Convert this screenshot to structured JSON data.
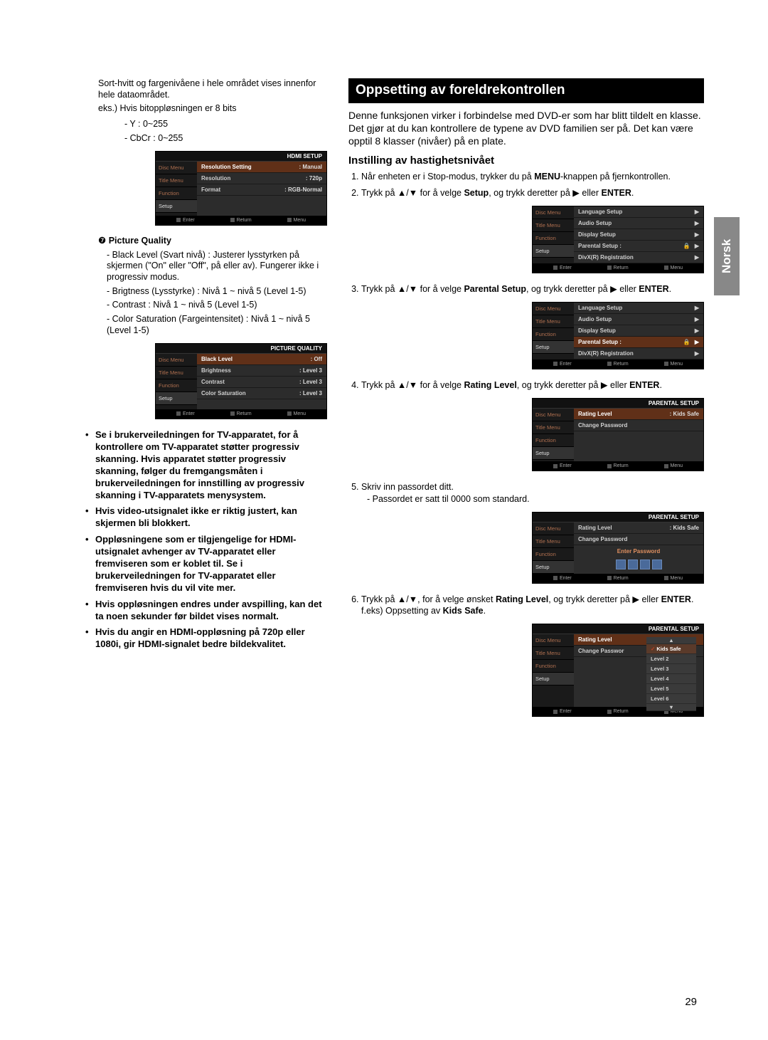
{
  "page_number": "29",
  "side_tab": "Norsk",
  "left": {
    "intro_lines": [
      "Sort-hvitt og fargenivåene i hele området vises innenfor hele dataområdet.",
      "eks.) Hvis bitoppløsningen er 8 bits"
    ],
    "ranges": [
      "- Y : 0~255",
      "- CbCr : 0~255"
    ],
    "osd_hdmi": {
      "title": "HDMI SETUP",
      "side": [
        "Disc Menu",
        "Title Menu",
        "Function",
        "Setup"
      ],
      "rows": [
        {
          "lbl": "Resolution Setting",
          "val": ": Manual",
          "hl": true
        },
        {
          "lbl": "Resolution",
          "val": ": 720p"
        },
        {
          "lbl": "Format",
          "val": ": RGB-Normal"
        }
      ],
      "foot": [
        "Enter",
        "Return",
        "Menu"
      ]
    },
    "pq_heading_num": "❼",
    "pq_heading": "Picture Quality",
    "pq_items": [
      "- Black Level (Svart nivå) : Justerer lysstyrken på skjermen (\"On\" eller \"Off\", på eller av). Fungerer ikke i progressiv modus.",
      "- Brigtness (Lysstyrke) : Nivå 1 ~ nivå 5 (Level 1-5)",
      "- Contrast : Nivå 1 ~ nivå 5 (Level 1-5)",
      "- Color Saturation (Fargeintensitet) : Nivå 1 ~ nivå 5 (Level 1-5)"
    ],
    "osd_pq": {
      "title": "PICTURE QUALITY",
      "side": [
        "Disc Menu",
        "Title Menu",
        "Function",
        "Setup"
      ],
      "rows": [
        {
          "lbl": "Black Level",
          "val": ": Off",
          "hl": true
        },
        {
          "lbl": "Brightness",
          "val": ": Level 3"
        },
        {
          "lbl": "Contrast",
          "val": ": Level 3"
        },
        {
          "lbl": "Color Saturation",
          "val": ": Level 3"
        }
      ],
      "foot": [
        "Enter",
        "Return",
        "Menu"
      ]
    },
    "notes": [
      "Se i brukerveiledningen for TV-apparatet, for å kontrollere om TV-apparatet støtter progressiv skanning.\nHvis apparatet støtter progressiv skanning, følger du fremgangsmåten i brukerveiledningen for innstilling av progressiv skanning i TV-apparatets menysystem.",
      "Hvis video-utsignalet ikke er riktig justert, kan skjermen bli blokkert.",
      "Oppløsningene som er tilgjengelige for HDMI-utsignalet avhenger av TV-apparatet eller fremviseren som er koblet til.\nSe i brukerveiledningen for TV-apparatet eller fremviseren hvis du vil vite mer.",
      "Hvis oppløsningen endres under avspilling, kan det ta noen sekunder før bildet vises normalt.",
      "Hvis du angir en HDMI-oppløsning på 720p eller 1080i, gir HDMI-signalet bedre bildekvalitet."
    ]
  },
  "right": {
    "section_title": "Oppsetting av foreldrekontrollen",
    "intro": "Denne funksjonen virker i forbindelse med DVD-er som har blitt tildelt en klasse. Det gjør at du kan kontrollere de typene av DVD familien ser på. Det kan være opptil 8 klasser (nivåer) på en plate.",
    "subhead": "Instilling av hastighetsnivået",
    "step1_a": "Når enheten er i Stop-modus, trykker du på ",
    "step1_b": "MENU",
    "step1_c": "-knappen på fjernkontrollen.",
    "step2_a": "Trykk på ▲/▼ for å velge ",
    "step2_b": "Setup",
    "step2_c": ", og trykk deretter på ▶ eller ",
    "step2_d": "ENTER",
    "step2_e": ".",
    "osd_setup": {
      "side": [
        "Disc Menu",
        "Title Menu",
        "Function",
        "Setup"
      ],
      "rows": [
        {
          "lbl": "Language Setup",
          "arrow": "▶"
        },
        {
          "lbl": "Audio Setup",
          "arrow": "▶"
        },
        {
          "lbl": "Display Setup",
          "arrow": "▶"
        },
        {
          "lbl": "Parental Setup :",
          "arrow": "▶",
          "icon": true
        },
        {
          "lbl": "DivX(R) Registration",
          "arrow": "▶"
        }
      ],
      "foot": [
        "Enter",
        "Return",
        "Menu"
      ]
    },
    "step3_a": "Trykk på ▲/▼ for å velge ",
    "step3_b": "Parental Setup",
    "step3_c": ", og trykk deretter på ▶ eller ",
    "step3_d": "ENTER",
    "step3_e": ".",
    "osd_setup2": {
      "side": [
        "Disc Menu",
        "Title Menu",
        "Function",
        "Setup"
      ],
      "rows": [
        {
          "lbl": "Language Setup",
          "arrow": "▶"
        },
        {
          "lbl": "Audio Setup",
          "arrow": "▶"
        },
        {
          "lbl": "Display Setup",
          "arrow": "▶"
        },
        {
          "lbl": "Parental Setup :",
          "arrow": "▶",
          "hl": true,
          "icon": true
        },
        {
          "lbl": "DivX(R) Registration",
          "arrow": "▶"
        }
      ],
      "foot": [
        "Enter",
        "Return",
        "Menu"
      ]
    },
    "step4_a": "Trykk på ▲/▼ for å velge ",
    "step4_b": "Rating Level",
    "step4_c": ", og trykk deretter på ▶ eller ",
    "step4_d": "ENTER",
    "step4_e": ".",
    "osd_parental1": {
      "title": "PARENTAL SETUP",
      "side": [
        "Disc Menu",
        "Title Menu",
        "Function",
        "Setup"
      ],
      "rows": [
        {
          "lbl": "Rating Level",
          "val": ": Kids Safe",
          "hl": true
        },
        {
          "lbl": "Change Password",
          "val": ""
        }
      ],
      "foot": [
        "Enter",
        "Return",
        "Menu"
      ]
    },
    "step5": "Skriv inn passordet ditt.",
    "step5_sub": "- Passordet er satt til 0000 som standard.",
    "osd_parental2": {
      "title": "PARENTAL SETUP",
      "side": [
        "Disc Menu",
        "Title Menu",
        "Function",
        "Setup"
      ],
      "rows": [
        {
          "lbl": "Rating Level",
          "val": ": Kids Safe"
        },
        {
          "lbl": "Change Password",
          "val": ""
        }
      ],
      "center": "Enter Password",
      "foot": [
        "Enter",
        "Return",
        "Menu"
      ]
    },
    "step6_a": "Trykk på ▲/▼, for å velge ønsket ",
    "step6_b": "Rating Level",
    "step6_c": ", og trykk deretter på ▶ eller ",
    "step6_d": "ENTER",
    "step6_e": ".",
    "step6_f": "f.eks) Oppsetting av ",
    "step6_g": "Kids Safe",
    "step6_h": ".",
    "osd_parental3": {
      "title": "PARENTAL SETUP",
      "side": [
        "Disc Menu",
        "Title Menu",
        "Function",
        "Setup"
      ],
      "rows": [
        {
          "lbl": "Rating Level"
        },
        {
          "lbl": "Change Passwor"
        }
      ],
      "submenu": [
        "Kids Safe",
        "Level 2",
        "Level 3",
        "Level 4",
        "Level 5",
        "Level 6"
      ],
      "foot": [
        "Enter",
        "Return",
        "Menu"
      ]
    }
  }
}
